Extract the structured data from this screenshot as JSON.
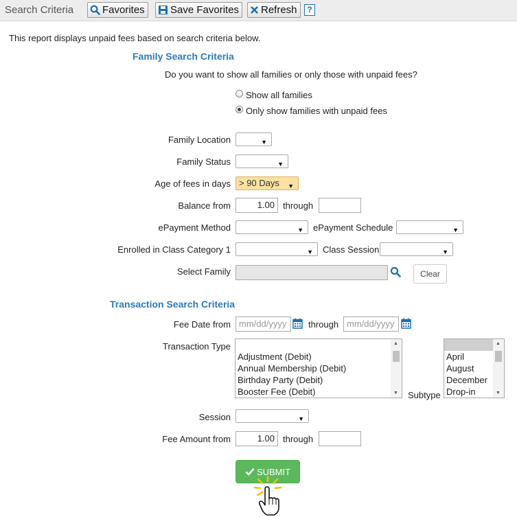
{
  "toolbar": {
    "title": "Search Criteria",
    "favorites_label": "Favorites",
    "save_favorites_label": "Save Favorites",
    "refresh_label": "Refresh",
    "help_label": "?"
  },
  "intro": "This report displays unpaid fees based on search criteria below.",
  "family": {
    "title": "Family Search Criteria",
    "question": "Do you want to show all families or only those with unpaid fees?",
    "radio_all": "Show all families",
    "radio_unpaid": "Only show families with unpaid fees",
    "selected_radio": "unpaid",
    "location_label": "Family Location",
    "location_value": "",
    "status_label": "Family Status",
    "status_value": "",
    "age_label": "Age of fees in days",
    "age_value": "> 90 Days",
    "balance_label": "Balance from",
    "balance_from": "1.00",
    "through_label": "through",
    "balance_to": "",
    "epay_method_label": "ePayment Method",
    "epay_method_value": "",
    "epay_schedule_label": "ePayment Schedule",
    "epay_schedule_value": "",
    "class_cat_label": "Enrolled in Class Category 1",
    "class_cat_value": "",
    "class_session_label": "Class Session",
    "class_session_value": "",
    "select_family_label": "Select Family",
    "select_family_value": "",
    "clear_label": "Clear"
  },
  "transaction": {
    "title": "Transaction Search Criteria",
    "fee_date_label": "Fee Date from",
    "date_placeholder": "mm/dd/yyyy",
    "through_label": "through",
    "type_label": "Transaction Type",
    "types": [
      "Adjustment (Debit)",
      "Annual Membership (Debit)",
      "Birthday Party (Debit)",
      "Booster Fee (Debit)"
    ],
    "subtype_label": "Subtype",
    "subtypes": [
      "",
      "April",
      "August",
      "December",
      "Drop-in"
    ],
    "session_label": "Session",
    "session_value": "",
    "fee_amount_label": "Fee Amount from",
    "fee_amount_from": "1.00",
    "fee_amount_to": ""
  },
  "submit_label": "SUBMIT",
  "colors": {
    "accent": "#2b7bb9",
    "submit": "#5cb85c",
    "age_highlight": "#f9e1a1"
  }
}
